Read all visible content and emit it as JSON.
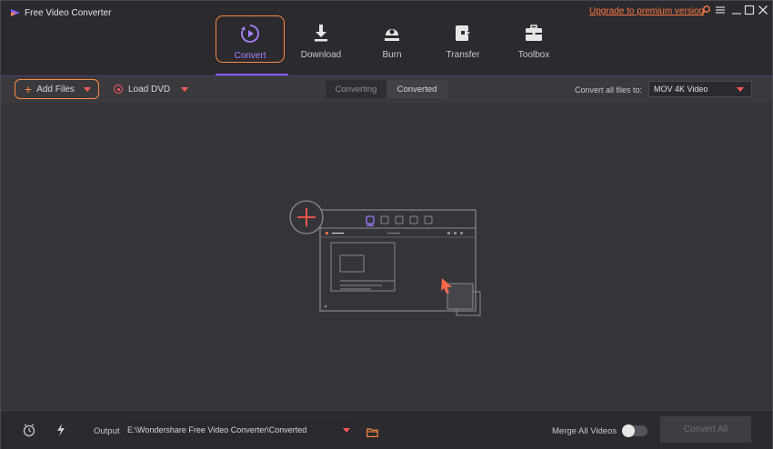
{
  "app": {
    "title": "Free Video Converter",
    "upgrade_link": "Upgrade to premium version"
  },
  "window_controls": [
    "search-icon",
    "menu-icon",
    "minimize-icon",
    "maximize-icon",
    "close-icon"
  ],
  "nav": {
    "items": [
      {
        "label": "Convert",
        "icon": "convert-play-icon",
        "active": true
      },
      {
        "label": "Download",
        "icon": "download-icon",
        "active": false
      },
      {
        "label": "Burn",
        "icon": "burn-disc-icon",
        "active": false
      },
      {
        "label": "Transfer",
        "icon": "transfer-icon",
        "active": false
      },
      {
        "label": "Toolbox",
        "icon": "toolbox-icon",
        "active": false
      }
    ]
  },
  "toolbar": {
    "add_files": "Add Files",
    "load_dvd": "Load DVD",
    "tabs": [
      {
        "label": "Converting",
        "selected": false
      },
      {
        "label": "Converted",
        "selected": true
      }
    ],
    "convert_all_label": "Convert all files to:",
    "format_value": "MOV 4K Video"
  },
  "bottom": {
    "output_label": "Output",
    "output_path": "E:\\Wondershare Free Video Converter\\Converted",
    "merge_label": "Merge All Videos",
    "merge_enabled": false,
    "convert_all_button": "Convert All"
  },
  "colors": {
    "accent_orange": "#ff8a3d",
    "accent_purple": "#a983ff",
    "link": "#ff7a45",
    "dropdown_caret": "#ff5a5a"
  }
}
